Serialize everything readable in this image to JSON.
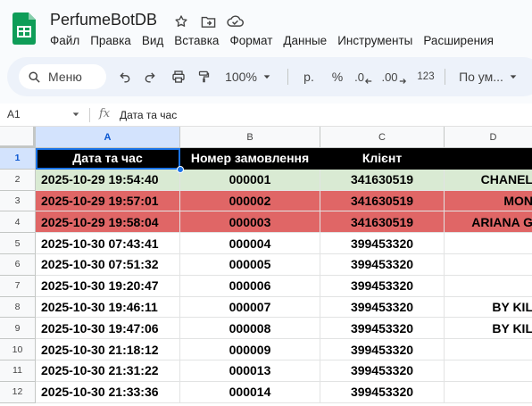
{
  "app": {
    "title": "PerfumeBotDB"
  },
  "menu": [
    "Файл",
    "Правка",
    "Вид",
    "Вставка",
    "Формат",
    "Данные",
    "Инструменты",
    "Расширения"
  ],
  "toolbar": {
    "search_label": "Меню",
    "zoom": "100%",
    "currency": "р.",
    "percent": "%",
    "decimal_decrease": ".0",
    "number_format": "123",
    "font": "По ум..."
  },
  "formula_bar": {
    "cell_ref": "A1",
    "fx": "fx",
    "value": "Дата та час"
  },
  "columns": [
    "A",
    "B",
    "C",
    "D"
  ],
  "rows": [
    {
      "n": "1",
      "style": "hdr",
      "cells": [
        "Дата та час",
        "Номер замовлення",
        "Клієнт",
        ""
      ]
    },
    {
      "n": "2",
      "style": "green",
      "cells": [
        "2025-10-29 19:54:40",
        "000001",
        "341630519",
        "CHANEL"
      ]
    },
    {
      "n": "3",
      "style": "red",
      "cells": [
        "2025-10-29 19:57:01",
        "000002",
        "341630519",
        "MON"
      ]
    },
    {
      "n": "4",
      "style": "red",
      "cells": [
        "2025-10-29 19:58:04",
        "000003",
        "341630519",
        "ARIANA G"
      ]
    },
    {
      "n": "5",
      "style": "",
      "cells": [
        "2025-10-30 07:43:41",
        "000004",
        "399453320",
        ""
      ]
    },
    {
      "n": "6",
      "style": "",
      "cells": [
        "2025-10-30 07:51:32",
        "000005",
        "399453320",
        ""
      ]
    },
    {
      "n": "7",
      "style": "",
      "cells": [
        "2025-10-30 19:20:47",
        "000006",
        "399453320",
        ""
      ]
    },
    {
      "n": "8",
      "style": "",
      "cells": [
        "2025-10-30 19:46:11",
        "000007",
        "399453320",
        "BY KIL"
      ]
    },
    {
      "n": "9",
      "style": "",
      "cells": [
        "2025-10-30 19:47:06",
        "000008",
        "399453320",
        "BY KIL"
      ]
    },
    {
      "n": "10",
      "style": "",
      "cells": [
        "2025-10-30 21:18:12",
        "000009",
        "399453320",
        ""
      ]
    },
    {
      "n": "11",
      "style": "",
      "cells": [
        "2025-10-30 21:31:22",
        "000013",
        "399453320",
        ""
      ]
    },
    {
      "n": "12",
      "style": "",
      "cells": [
        "2025-10-30 21:33:36",
        "000014",
        "399453320",
        ""
      ]
    }
  ],
  "colors": {
    "header_bg": "#000000",
    "green_row": "#d9ead3",
    "red_row": "#e06666",
    "selection": "#1a73e8"
  }
}
